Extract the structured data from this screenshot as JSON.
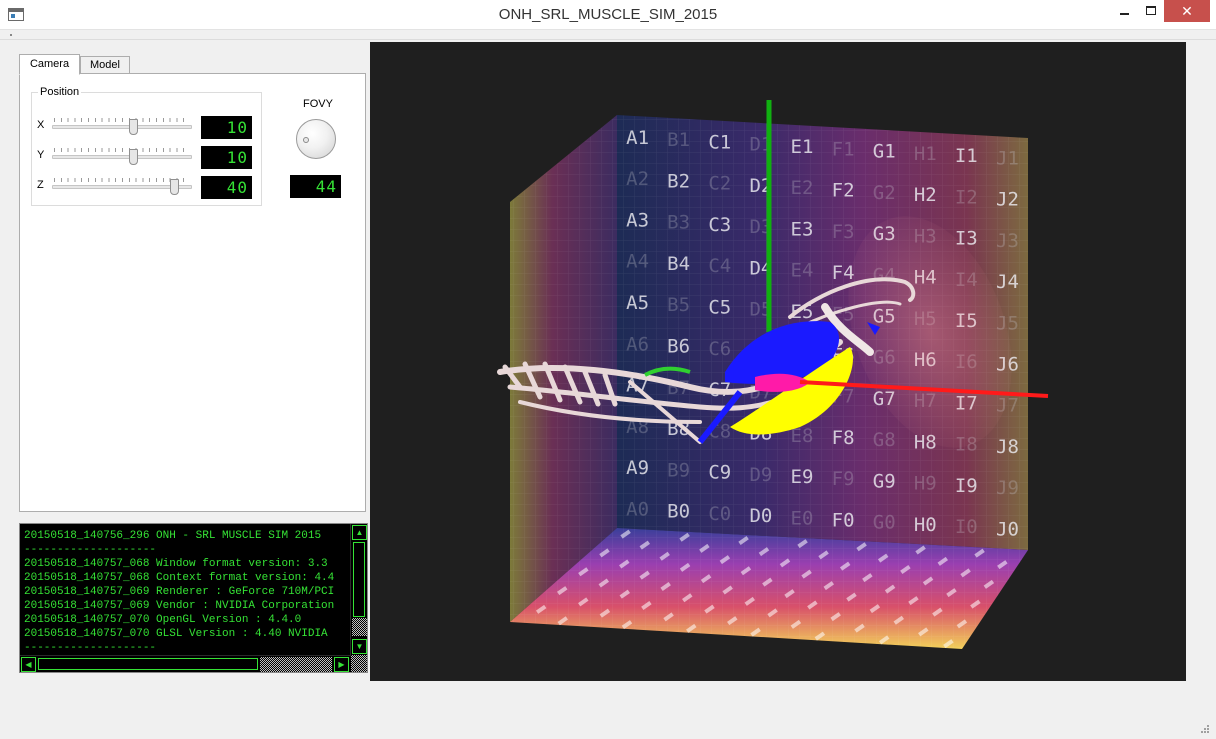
{
  "window": {
    "title": "ONH_SRL_MUSCLE_SIM_2015",
    "minimize_symbol": "",
    "maximize_symbol": "",
    "close_symbol": "✕"
  },
  "tabs": [
    {
      "label": "Camera",
      "active": true
    },
    {
      "label": "Model",
      "active": false
    }
  ],
  "camera": {
    "group_title": "Position",
    "axes": [
      {
        "label": "X",
        "value": "10",
        "slider_fraction": 0.58
      },
      {
        "label": "Y",
        "value": "10",
        "slider_fraction": 0.58
      },
      {
        "label": "Z",
        "value": "40",
        "slider_fraction": 0.87
      }
    ],
    "fovy": {
      "label": "FOVY",
      "value": "44"
    }
  },
  "log": {
    "lines": [
      "20150518_140756_296 ONH - SRL MUSCLE SIM 2015",
      "--------------------",
      "20150518_140757_068 Window format version: 3.3",
      "20150518_140757_068 Context format version: 4.4",
      "20150518_140757_069 Renderer : GeForce 710M/PCI",
      "20150518_140757_069 Vendor : NVIDIA Corporation",
      "20150518_140757_070 OpenGL Version : 4.4.0",
      "20150518_140757_070 GLSL Version : 4.40 NVIDIA",
      "--------------------"
    ],
    "text_color": "#35e235"
  },
  "scene": {
    "back_wall_labels": [
      [
        "A1",
        "B1",
        "C1",
        "D1",
        "E1",
        "F1",
        "G1",
        "H1",
        "I1",
        "J1"
      ],
      [
        "A2",
        "B2",
        "C2",
        "D2",
        "E2",
        "F2",
        "G2",
        "H2",
        "I2",
        "J2"
      ],
      [
        "A3",
        "B3",
        "C3",
        "D3",
        "E3",
        "F3",
        "G3",
        "H3",
        "I3",
        "J3"
      ],
      [
        "A4",
        "B4",
        "C4",
        "D4",
        "E4",
        "F4",
        "G4",
        "H4",
        "I4",
        "J4"
      ],
      [
        "A5",
        "B5",
        "C5",
        "D5",
        "E5",
        "F5",
        "G5",
        "H5",
        "I5",
        "J5"
      ],
      [
        "A6",
        "B6",
        "C6",
        "D6",
        "E6",
        "F6",
        "G6",
        "H6",
        "I6",
        "J6"
      ],
      [
        "A7",
        "B7",
        "C7",
        "D7",
        "E7",
        "F7",
        "G7",
        "H7",
        "I7",
        "J7"
      ],
      [
        "A8",
        "B8",
        "C8",
        "D8",
        "E8",
        "F8",
        "G8",
        "H8",
        "I8",
        "J8"
      ],
      [
        "A9",
        "B9",
        "C9",
        "D9",
        "E9",
        "F9",
        "G9",
        "H9",
        "I9",
        "J9"
      ],
      [
        "A0",
        "B0",
        "C0",
        "D0",
        "E0",
        "F0",
        "G0",
        "H0",
        "I0",
        "J0"
      ]
    ],
    "axis_colors": {
      "x": "#ff1a1a",
      "y": "#10b010",
      "z": "#1a2cff"
    },
    "muscle_colors": [
      "#1a1aff",
      "#ffff00",
      "#ff1aa8",
      "#30d030"
    ]
  }
}
